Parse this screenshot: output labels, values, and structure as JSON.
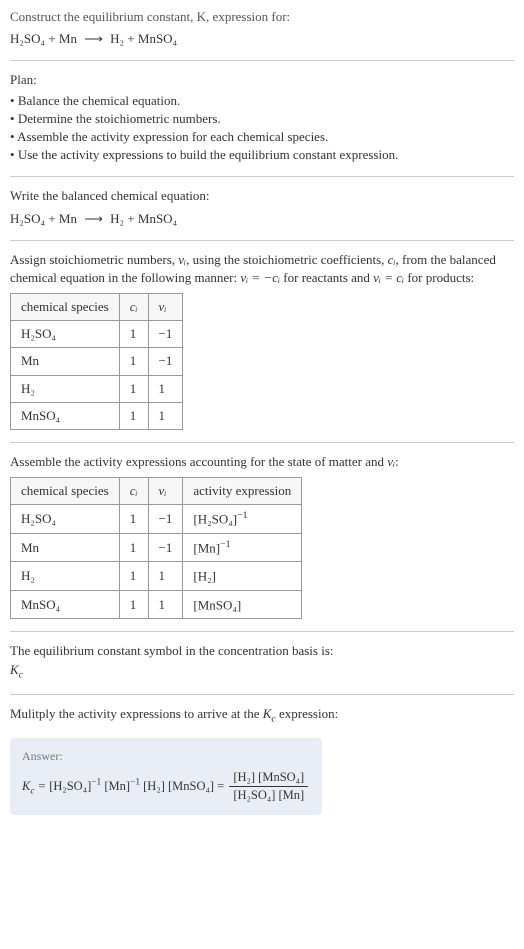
{
  "prompt": {
    "line1": "Construct the equilibrium constant, K, expression for:",
    "equation_lhs_1": "H₂SO₄",
    "equation_lhs_2": "Mn",
    "equation_rhs_1": "H₂",
    "equation_rhs_2": "MnSO₄",
    "arrow": "⟶"
  },
  "plan": {
    "heading": "Plan:",
    "items": [
      "Balance the chemical equation.",
      "Determine the stoichiometric numbers.",
      "Assemble the activity expression for each chemical species.",
      "Use the activity expressions to build the equilibrium constant expression."
    ]
  },
  "balanced": {
    "heading": "Write the balanced chemical equation:",
    "equation_lhs_1": "H₂SO₄",
    "equation_lhs_2": "Mn",
    "equation_rhs_1": "H₂",
    "equation_rhs_2": "MnSO₄",
    "arrow": "⟶"
  },
  "stoich_text": {
    "part1": "Assign stoichiometric numbers, ",
    "nu": "νᵢ",
    "part2": ", using the stoichiometric coefficients, ",
    "ci": "cᵢ",
    "part3": ", from the balanced chemical equation in the following manner: ",
    "rel1": "νᵢ = −cᵢ",
    "part4": " for reactants and ",
    "rel2": "νᵢ = cᵢ",
    "part5": " for products:"
  },
  "stoich_table": {
    "headers": [
      "chemical species",
      "cᵢ",
      "νᵢ"
    ],
    "rows": [
      [
        "H₂SO₄",
        "1",
        "−1"
      ],
      [
        "Mn",
        "1",
        "−1"
      ],
      [
        "H₂",
        "1",
        "1"
      ],
      [
        "MnSO₄",
        "1",
        "1"
      ]
    ]
  },
  "activity_heading": {
    "part1": "Assemble the activity expressions accounting for the state of matter and ",
    "nu": "νᵢ",
    "part2": ":"
  },
  "activity_table": {
    "headers": [
      "chemical species",
      "cᵢ",
      "νᵢ",
      "activity expression"
    ],
    "rows": [
      {
        "species": "H₂SO₄",
        "c": "1",
        "nu": "−1",
        "expr_base": "[H₂SO₄]",
        "expr_exp": "−1"
      },
      {
        "species": "Mn",
        "c": "1",
        "nu": "−1",
        "expr_base": "[Mn]",
        "expr_exp": "−1"
      },
      {
        "species": "H₂",
        "c": "1",
        "nu": "1",
        "expr_base": "[H₂]",
        "expr_exp": ""
      },
      {
        "species": "MnSO₄",
        "c": "1",
        "nu": "1",
        "expr_base": "[MnSO₄]",
        "expr_exp": ""
      }
    ]
  },
  "kc_symbol": {
    "line1": "The equilibrium constant symbol in the concentration basis is:",
    "symbol": "K_c"
  },
  "multiply_heading": "Mulitply the activity expressions to arrive at the K_c expression:",
  "answer": {
    "label": "Answer:",
    "lhs": "K_c = ",
    "term1_base": "[H₂SO₄]",
    "term1_exp": "−1",
    "term2_base": "[Mn]",
    "term2_exp": "−1",
    "term3": "[H₂]",
    "term4": "[MnSO₄]",
    "eq": " = ",
    "frac_num": "[H₂] [MnSO₄]",
    "frac_den": "[H₂SO₄] [Mn]"
  },
  "chart_data": {
    "type": "table",
    "tables": [
      {
        "title": "Stoichiometric numbers",
        "headers": [
          "chemical species",
          "c_i",
          "nu_i"
        ],
        "rows": [
          [
            "H2SO4",
            1,
            -1
          ],
          [
            "Mn",
            1,
            -1
          ],
          [
            "H2",
            1,
            1
          ],
          [
            "MnSO4",
            1,
            1
          ]
        ]
      },
      {
        "title": "Activity expressions",
        "headers": [
          "chemical species",
          "c_i",
          "nu_i",
          "activity expression"
        ],
        "rows": [
          [
            "H2SO4",
            1,
            -1,
            "[H2SO4]^-1"
          ],
          [
            "Mn",
            1,
            -1,
            "[Mn]^-1"
          ],
          [
            "H2",
            1,
            1,
            "[H2]"
          ],
          [
            "MnSO4",
            1,
            1,
            "[MnSO4]"
          ]
        ]
      }
    ]
  }
}
